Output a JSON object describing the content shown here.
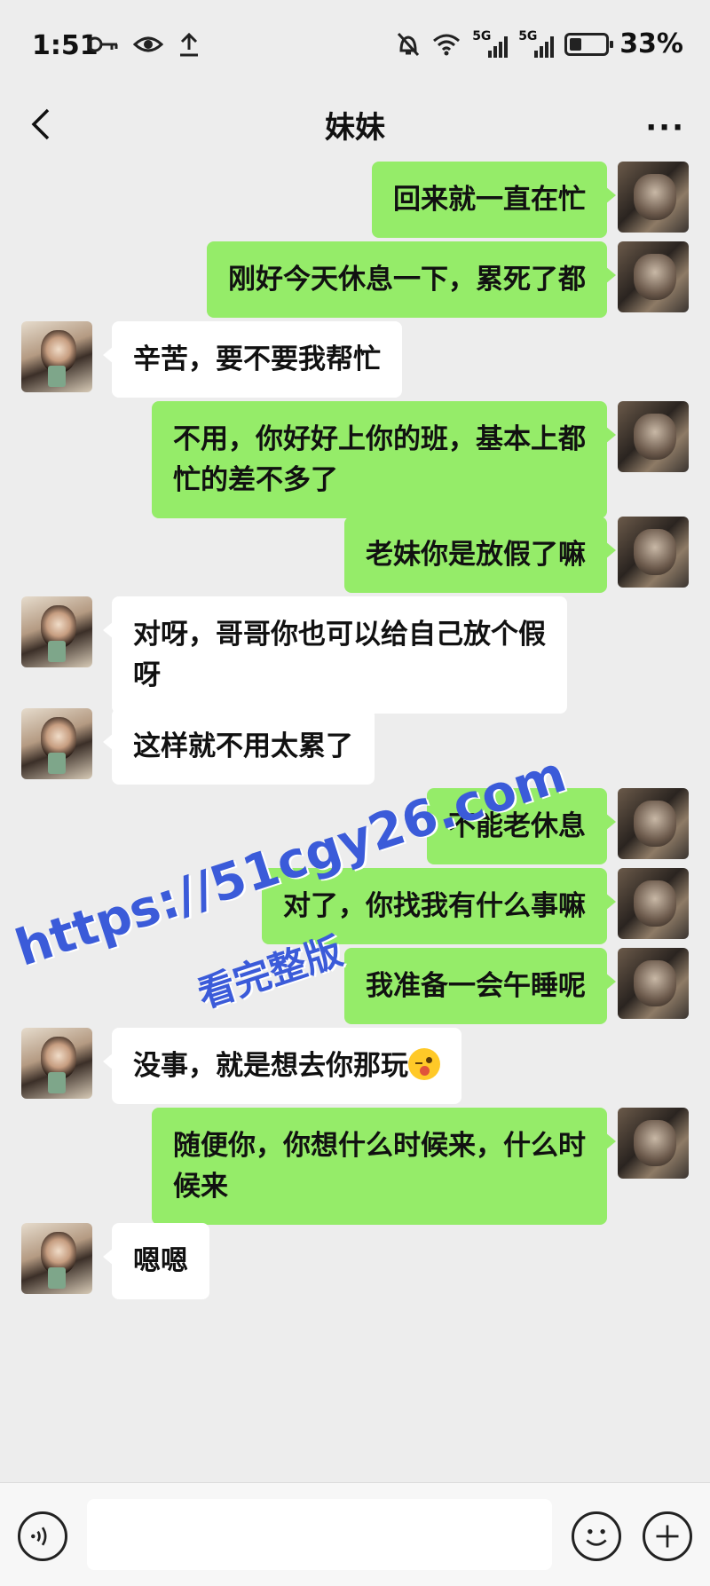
{
  "status_bar": {
    "time": "1:51",
    "network_1": "5G",
    "network_2": "5G",
    "battery_text": "33%",
    "battery_level": 0.33,
    "icons": [
      "key-icon",
      "eye-icon",
      "upload-icon",
      "mute-icon",
      "wifi-icon",
      "signal-icon",
      "battery-icon"
    ]
  },
  "header": {
    "title": "妹妹",
    "back_icon": "chevron-left-icon",
    "more_label": "···"
  },
  "messages": [
    {
      "from": "me",
      "text": "回来就一直在忙"
    },
    {
      "from": "me",
      "text": "刚好今天休息一下，累死了都"
    },
    {
      "from": "her",
      "text": "辛苦，要不要我帮忙"
    },
    {
      "from": "me",
      "text": "不用，你好好上你的班，基本上都\n忙的差不多了"
    },
    {
      "from": "me",
      "text": "老妹你是放假了嘛"
    },
    {
      "from": "her",
      "text": "对呀，哥哥你也可以给自己放个假\n呀"
    },
    {
      "from": "her",
      "text": "这样就不用太累了"
    },
    {
      "from": "me",
      "text": "不能老休息"
    },
    {
      "from": "me",
      "text": "对了，你找我有什么事嘛"
    },
    {
      "from": "me",
      "text": "我准备一会午睡呢"
    },
    {
      "from": "her",
      "text": "没事，就是想去你那玩",
      "emoji": "winking-tongue-emoji"
    },
    {
      "from": "me",
      "text": "随便你，你想什么时候来，什么时\n候来"
    },
    {
      "from": "her",
      "text": "嗯嗯"
    }
  ],
  "watermark": {
    "line1": "https://51cgy26.com",
    "line2": "看完整版",
    "color": "#3b5bd9"
  },
  "input_bar": {
    "icons": [
      "voice-icon",
      "emoji-icon",
      "plus-icon"
    ]
  },
  "colors": {
    "my_bubble": "#95ec69",
    "her_bubble": "#ffffff",
    "background": "#ededed"
  }
}
